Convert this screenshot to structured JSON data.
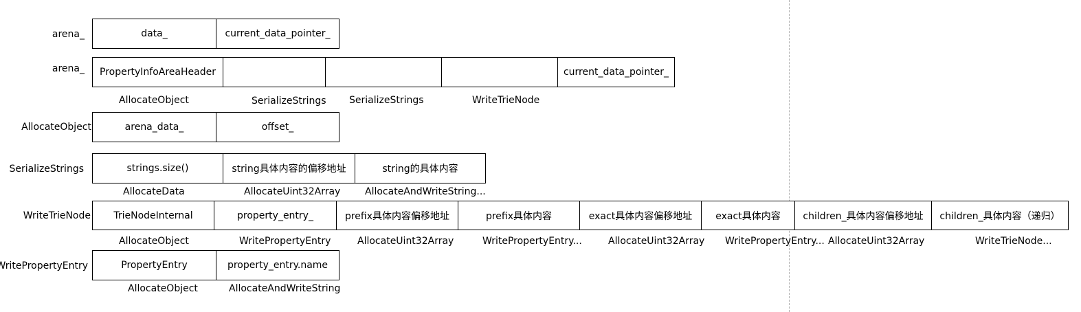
{
  "rows": {
    "arena1": {
      "label": "arena_",
      "cells": [
        "data_",
        "current_data_pointer_"
      ]
    },
    "arena2": {
      "label": "arena_",
      "cells": [
        "PropertyInfoAreaHeader",
        "",
        "",
        "",
        "current_data_pointer_"
      ],
      "captions": [
        "AllocateObject",
        "SerializeStrings",
        "SerializeStrings",
        "WriteTrieNode"
      ]
    },
    "allocate_object": {
      "label": "AllocateObject",
      "cells": [
        "arena_data_",
        "offset_"
      ]
    },
    "serialize_strings": {
      "label": "SerializeStrings",
      "cells": [
        "strings.size()",
        "string具体内容的偏移地址",
        "string的具体内容"
      ],
      "captions": [
        "AllocateData",
        "AllocateUint32Array",
        "AllocateAndWriteString..."
      ]
    },
    "write_trie_node": {
      "label": "WriteTrieNode",
      "cells": [
        "TrieNodeInternal",
        "property_entry_",
        "prefix具体内容偏移地址",
        "prefix具体内容",
        "exact具体内容偏移地址",
        "exact具体内容",
        "children_具体内容偏移地址",
        "children_具体内容（递归）"
      ],
      "captions": [
        "AllocateObject",
        "WritePropertyEntry",
        "AllocateUint32Array",
        "WritePropertyEntry...",
        "AllocateUint32Array",
        "WritePropertyEntry...",
        "AllocateUint32Array",
        "WriteTrieNode..."
      ]
    },
    "write_property_entry": {
      "label": "WritePropertyEntry",
      "cells": [
        "PropertyEntry",
        "property_entry.name"
      ],
      "captions": [
        "AllocateObject",
        "AllocateAndWriteString"
      ]
    }
  }
}
